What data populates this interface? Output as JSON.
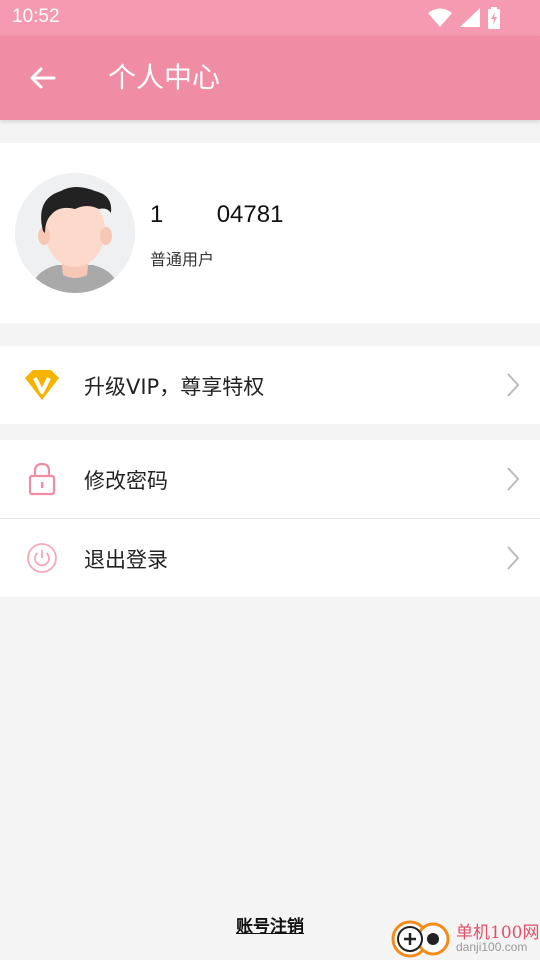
{
  "status_bar": {
    "time": "10:52",
    "icons": [
      "wifi-icon",
      "signal-icon",
      "battery-icon"
    ]
  },
  "app_bar": {
    "title": "个人中心",
    "back_icon": "arrow-left-icon"
  },
  "profile": {
    "username": "1        04781",
    "user_type": "普通用户",
    "avatar_icon": "avatar"
  },
  "menu": {
    "vip": {
      "label": "升级VIP，尊享特权",
      "icon": "vip-diamond-icon"
    },
    "change_password": {
      "label": "修改密码",
      "icon": "lock-icon"
    },
    "logout": {
      "label": "退出登录",
      "icon": "power-icon"
    }
  },
  "footer": {
    "cancel_account": "账号注销"
  },
  "watermark": {
    "title": "单机100网",
    "url": "danji100.com"
  },
  "colors": {
    "status_bar": "#f59ab0",
    "app_bar": "#f08ca3",
    "accent_pink": "#f08ca3",
    "vip_gold": "#f5b400"
  }
}
